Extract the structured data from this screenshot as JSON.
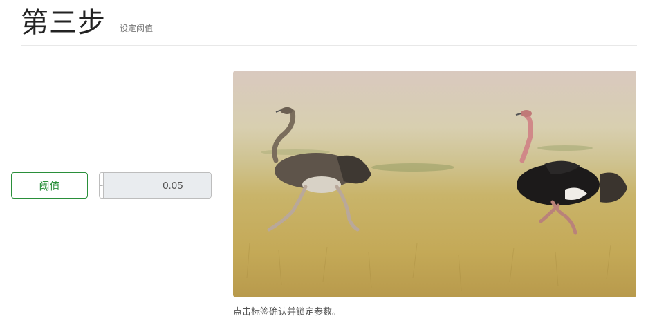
{
  "header": {
    "title": "第三步",
    "subtitle": "设定阈值"
  },
  "controls": {
    "threshold_label": "阈值",
    "decrement_label": "-",
    "increment_label": "+",
    "value": "0.05"
  },
  "image": {
    "caption": "点击标签确认并锁定参数。"
  },
  "colors": {
    "accent": "#2a8f3a"
  }
}
